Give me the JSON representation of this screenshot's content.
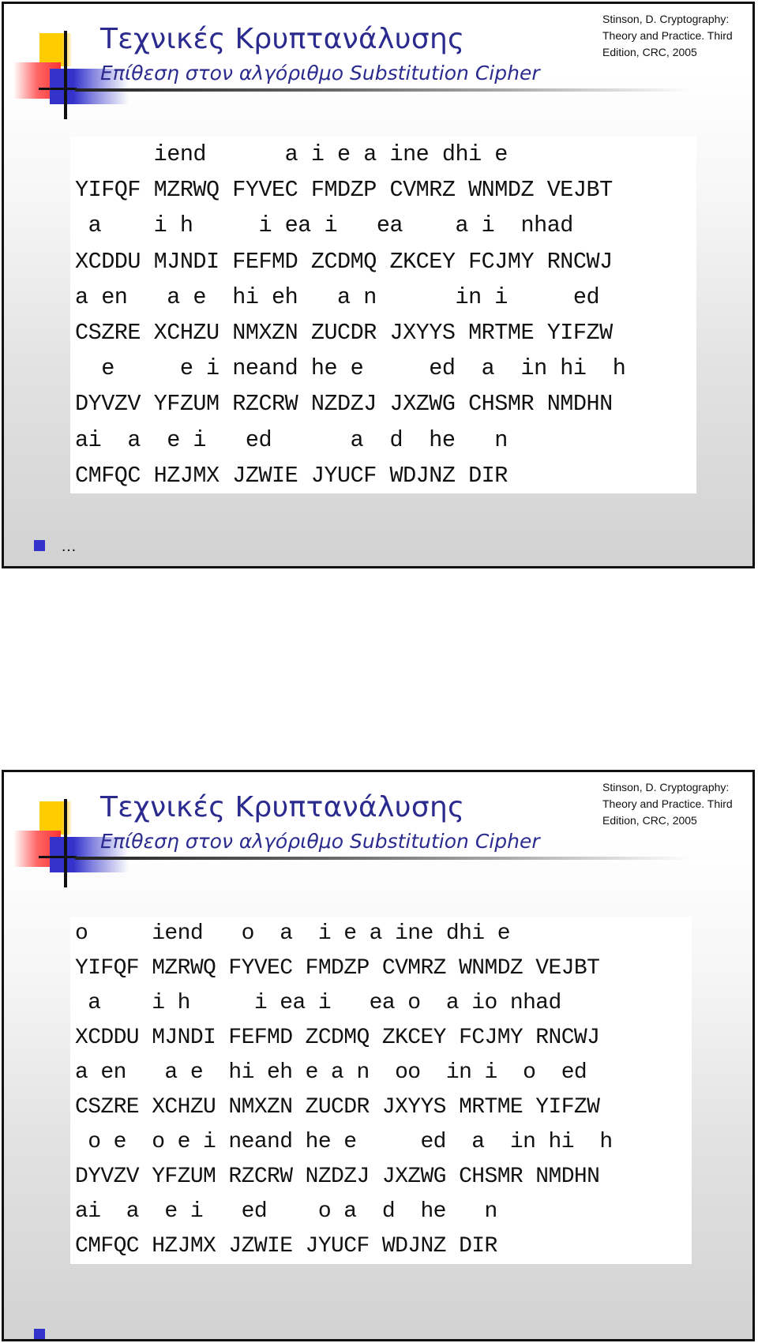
{
  "slides": [
    {
      "title": "Τεχνικές Κρυπτανάλυσης",
      "subtitle": "Επίθεση στον αλγόριθμο Substitution Cipher",
      "reference": [
        "Stinson, D. Cryptography:",
        "Theory and Practice. Third",
        "Edition, CRC, 2005"
      ],
      "cipher_lines": [
        "      iend      a i e a ine dhi e      ",
        "YIFQF MZRWQ FYVEC FMDZP CVMRZ WNMDZ VEJBT",
        " a    i h     i ea i   ea    a i  nhad ",
        "XCDDU MJNDI FEFMD ZCDMQ ZKCEY FCJMY RNCWJ",
        "a en   a e  hi eh   a n      in i     ed",
        "CSZRE XCHZU NMXZN ZUCDR JXYYS MRTME YIFZW",
        "  e     e i neand he e     ed  a  in hi  h",
        "DYVZV YFZUM RZCRW NZDZJ JXZWG CHSMR NMDHN",
        "ai  a  e i   ed      a  d  he   n       ",
        "CMFQC HZJMX JZWIE JYUCF WDJNZ DIR"
      ],
      "bullet_text": "…"
    },
    {
      "title": "Τεχνικές Κρυπτανάλυσης",
      "subtitle": "Επίθεση στον αλγόριθμο Substitution Cipher",
      "reference": [
        "Stinson, D. Cryptography:",
        "Theory and Practice. Third",
        "Edition, CRC, 2005"
      ],
      "cipher_lines": [
        "o     iend   o  a  i e a ine dhi e      ",
        "YIFQF MZRWQ FYVEC FMDZP CVMRZ WNMDZ VEJBT",
        " a    i h     i ea i   ea o  a io nhad ",
        "XCDDU MJNDI FEFMD ZCDMQ ZKCEY FCJMY RNCWJ",
        "a en   a e  hi eh e a n  oo  in i  o  ed",
        "CSZRE XCHZU NMXZN ZUCDR JXYYS MRTME YIFZW",
        " o e  o e i neand he e     ed  a  in hi  h",
        "DYVZV YFZUM RZCRW NZDZJ JXZWG CHSMR NMDHN",
        "ai  a  e i   ed    o a  d  he   n       ",
        "CMFQC HZJMX JZWIE JYUCF WDJNZ DIR"
      ],
      "bullet_text": ""
    }
  ]
}
